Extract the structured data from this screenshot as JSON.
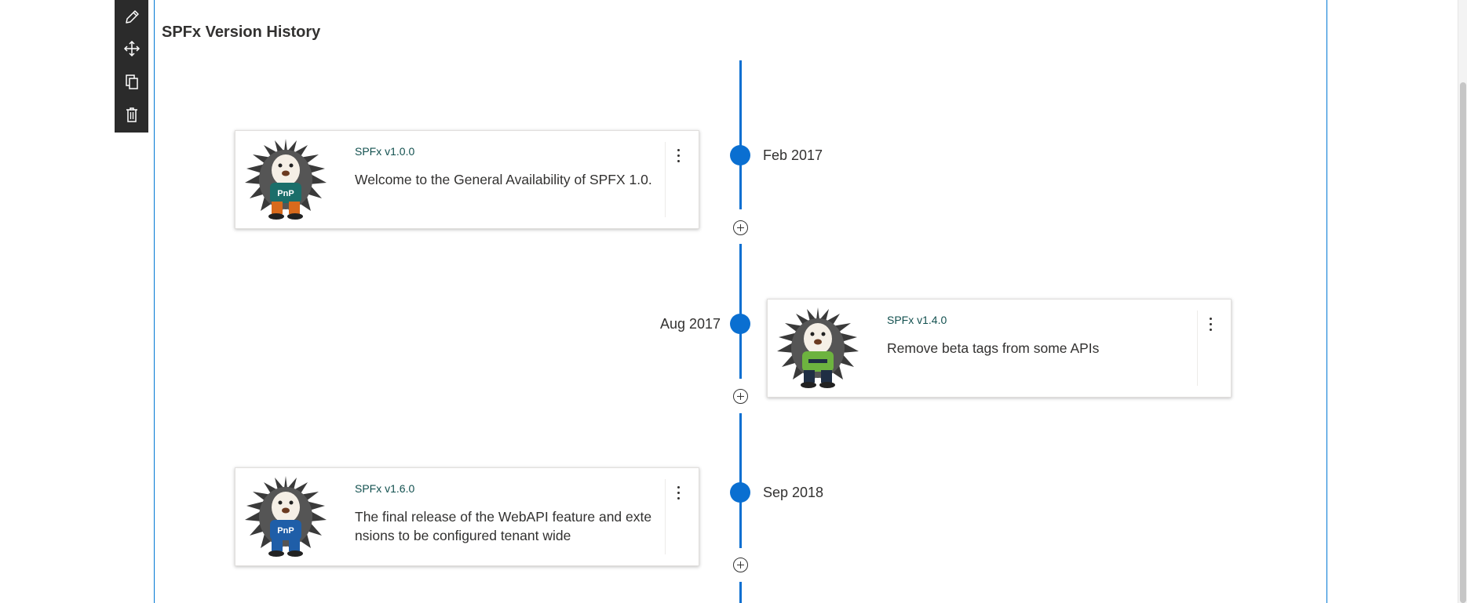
{
  "toolbar": {
    "items": [
      {
        "name": "edit-webpart-button",
        "icon": "pencil-icon"
      },
      {
        "name": "move-webpart-button",
        "icon": "move-icon"
      },
      {
        "name": "duplicate-webpart-button",
        "icon": "copy-icon"
      },
      {
        "name": "delete-webpart-button",
        "icon": "trash-icon"
      }
    ]
  },
  "webpart": {
    "title": "SPFx Version History"
  },
  "timeline": {
    "accent_color": "#0a6fd1",
    "events": [
      {
        "date": "Feb 2017",
        "title": "SPFx v1.0.0",
        "description": "Welcome to the General Availability of SPFX 1.0.",
        "shirt_color": "#1b6e6a",
        "shirt_label": "PnP",
        "pants_color": "#d86a1c"
      },
      {
        "date": "Aug 2017",
        "title": "SPFx v1.4.0",
        "description": "Remove beta tags from some APIs",
        "shirt_color": "#6db33f",
        "shirt_label": "",
        "pants_color": "#1f2e44"
      },
      {
        "date": "Sep 2018",
        "title": "SPFx v1.6.0",
        "description": "The final release of the WebAPI feature and extensions to be configured tenant wide",
        "shirt_color": "#1f5ea8",
        "shirt_label": "PnP",
        "pants_color": "#1f5ea8"
      }
    ]
  },
  "colors": {
    "selection_border": "#0078d4",
    "card_title": "#12504f",
    "toolbar_bg": "#2b2b2b"
  }
}
